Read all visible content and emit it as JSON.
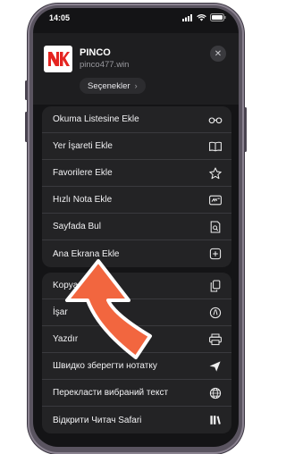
{
  "status_bar": {
    "time": "14:05"
  },
  "site": {
    "logo_text": "NK",
    "title": "PINCO",
    "domain": "pinco477.win",
    "options_label": "Seçenekler",
    "options_chevron": "›"
  },
  "close_icon": "✕",
  "menu_group_1": [
    {
      "label": "Okuma Listesine Ekle",
      "icon": "glasses-icon"
    },
    {
      "label": "Yer İşareti Ekle",
      "icon": "book-icon"
    },
    {
      "label": "Favorilere Ekle",
      "icon": "star-icon"
    },
    {
      "label": "Hızlı Nota Ekle",
      "icon": "quick-note-icon"
    },
    {
      "label": "Sayfada Bul",
      "icon": "find-in-page-icon"
    },
    {
      "label": "Ana Ekrana Ekle",
      "icon": "add-square-icon"
    }
  ],
  "menu_group_2": [
    {
      "label": "Kopya",
      "icon": "copy-icon"
    },
    {
      "label": "İşar",
      "icon": "markup-icon"
    },
    {
      "label": "Yazdır",
      "icon": "printer-icon"
    },
    {
      "label": "Швидко зберегти нотатку",
      "icon": "send-icon"
    },
    {
      "label": "Перекласти вибраний текст",
      "icon": "globe-icon"
    },
    {
      "label": "Відкрити Читач Safari",
      "icon": "library-icon"
    }
  ],
  "colors": {
    "background": "#141416",
    "arrow": "#f2663f",
    "logo": "#e52420"
  }
}
